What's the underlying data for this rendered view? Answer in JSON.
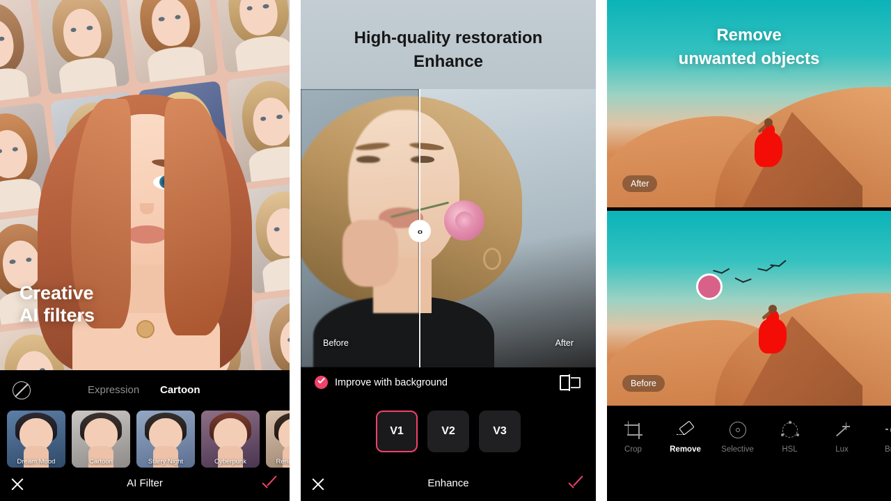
{
  "screens": [
    {
      "id": "ai-filter",
      "caption_line1": "Creative",
      "caption_line2": "AI filters",
      "tabs": {
        "inactive": "Expression",
        "active": "Cartoon"
      },
      "no_filter_icon": "no-filter-icon",
      "filters": [
        {
          "label": "Dream Mood",
          "selected": false
        },
        {
          "label": "Cartoon",
          "selected": true
        },
        {
          "label": "Starry Night",
          "selected": false
        },
        {
          "label": "Cyberpunk",
          "selected": false
        },
        {
          "label": "Renaissance",
          "selected": false
        }
      ],
      "footer_label": "AI Filter",
      "close_icon": "close-icon",
      "confirm_icon": "check-icon"
    },
    {
      "id": "enhance",
      "title_line1": "High-quality restoration",
      "title_line2": "Enhance",
      "before_label": "Before",
      "after_label": "After",
      "slider_handle_glyph": "‹›",
      "option_label": "Improve with background",
      "option_checked": true,
      "compare_icon": "compare-split-icon",
      "versions": [
        {
          "label": "V1",
          "selected": true
        },
        {
          "label": "V2",
          "selected": false
        },
        {
          "label": "V3",
          "selected": false
        }
      ],
      "footer_label": "Enhance",
      "close_icon": "close-icon",
      "confirm_icon": "check-icon"
    },
    {
      "id": "remove",
      "title_line1": "Remove",
      "title_line2": "unwanted objects",
      "after_badge": "After",
      "before_badge": "Before",
      "brush_color": "#d86189",
      "tools": [
        {
          "label": "Crop",
          "icon": "crop-icon",
          "active": false
        },
        {
          "label": "Remove",
          "icon": "eraser-icon",
          "active": true
        },
        {
          "label": "Selective",
          "icon": "selective-target-icon",
          "active": false
        },
        {
          "label": "HSL",
          "icon": "hsl-ring-icon",
          "active": false
        },
        {
          "label": "Lux",
          "icon": "magic-wand-icon",
          "active": false
        },
        {
          "label": "Brigh",
          "icon": "brightness-sun-icon",
          "active": false
        }
      ]
    }
  ],
  "colors": {
    "accent": "#f0426b",
    "background": "#000000",
    "panel_gap": "#ffffff",
    "teal_sky": "#0bb3b8",
    "sand": "#cf7f48",
    "dress_red": "#f40d07"
  }
}
